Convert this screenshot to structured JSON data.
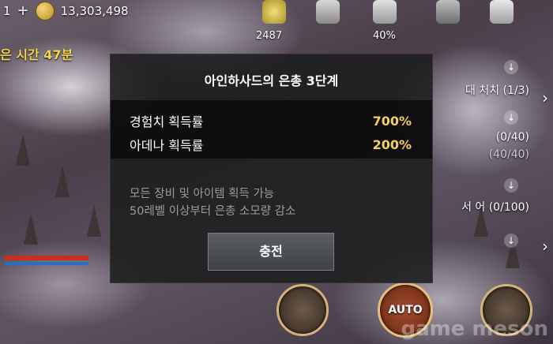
{
  "hud": {
    "level": "1",
    "gold": "13,303,498",
    "timer_text": "은 시간 47분",
    "item_count": "2487",
    "percent": "40%"
  },
  "quests": [
    {
      "text": "대 처치  (1/3)"
    },
    {
      "text": "(0/40)"
    },
    {
      "text": "(40/40)"
    },
    {
      "text": "서 어 (0/100)"
    }
  ],
  "auto_label": "AUTO",
  "watermark": "game meson",
  "dialog": {
    "title": "아인하사드의 은총 3단계",
    "stats": [
      {
        "label": "경험치 획득률",
        "value": "700%"
      },
      {
        "label": "아데나 획득률",
        "value": "200%"
      }
    ],
    "desc_line1": "모든 장비 및 아이템 획득 가능",
    "desc_line2": "50레벨 이상부터 은총 소모량 감소",
    "charge_label": "충전"
  }
}
